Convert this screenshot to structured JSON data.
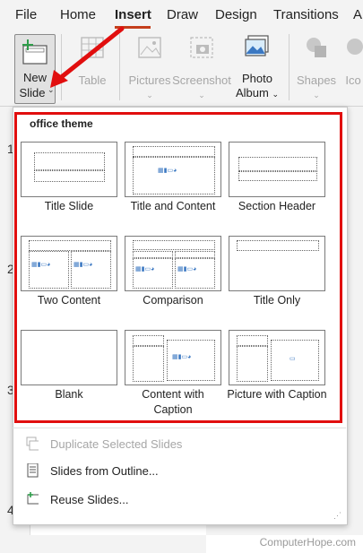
{
  "menu": {
    "items": [
      "File",
      "Home",
      "Insert",
      "Draw",
      "Design",
      "Transitions",
      "A"
    ],
    "active": "Insert"
  },
  "ribbon": {
    "new_slide": {
      "line1": "New",
      "line2": "Slide"
    },
    "table": "Table",
    "pictures": "Pictures",
    "screenshot": "Screenshot",
    "photo_album": {
      "line1": "Photo",
      "line2": "Album"
    },
    "shapes": "Shapes",
    "icons": "Ico"
  },
  "panel": {
    "theme_title": "office theme",
    "layouts": [
      {
        "label": "Title Slide"
      },
      {
        "label": "Title and Content"
      },
      {
        "label": "Section Header"
      },
      {
        "label": "Two Content"
      },
      {
        "label": "Comparison"
      },
      {
        "label": "Title Only"
      },
      {
        "label": "Blank"
      },
      {
        "label": "Content with Caption"
      },
      {
        "label": "Picture with Caption"
      }
    ],
    "commands": [
      {
        "label": "Duplicate Selected Slides",
        "enabled": false
      },
      {
        "label": "Slides from Outline...",
        "enabled": true
      },
      {
        "label": "Reuse Slides...",
        "enabled": true
      }
    ]
  },
  "slide_numbers": [
    "1",
    "2",
    "3",
    "4"
  ],
  "watermark": "ComputerHope.com",
  "colors": {
    "highlight_box": "#e10e0e",
    "arrow": "#e10e0e",
    "tab_underline": "#c43e1c"
  }
}
